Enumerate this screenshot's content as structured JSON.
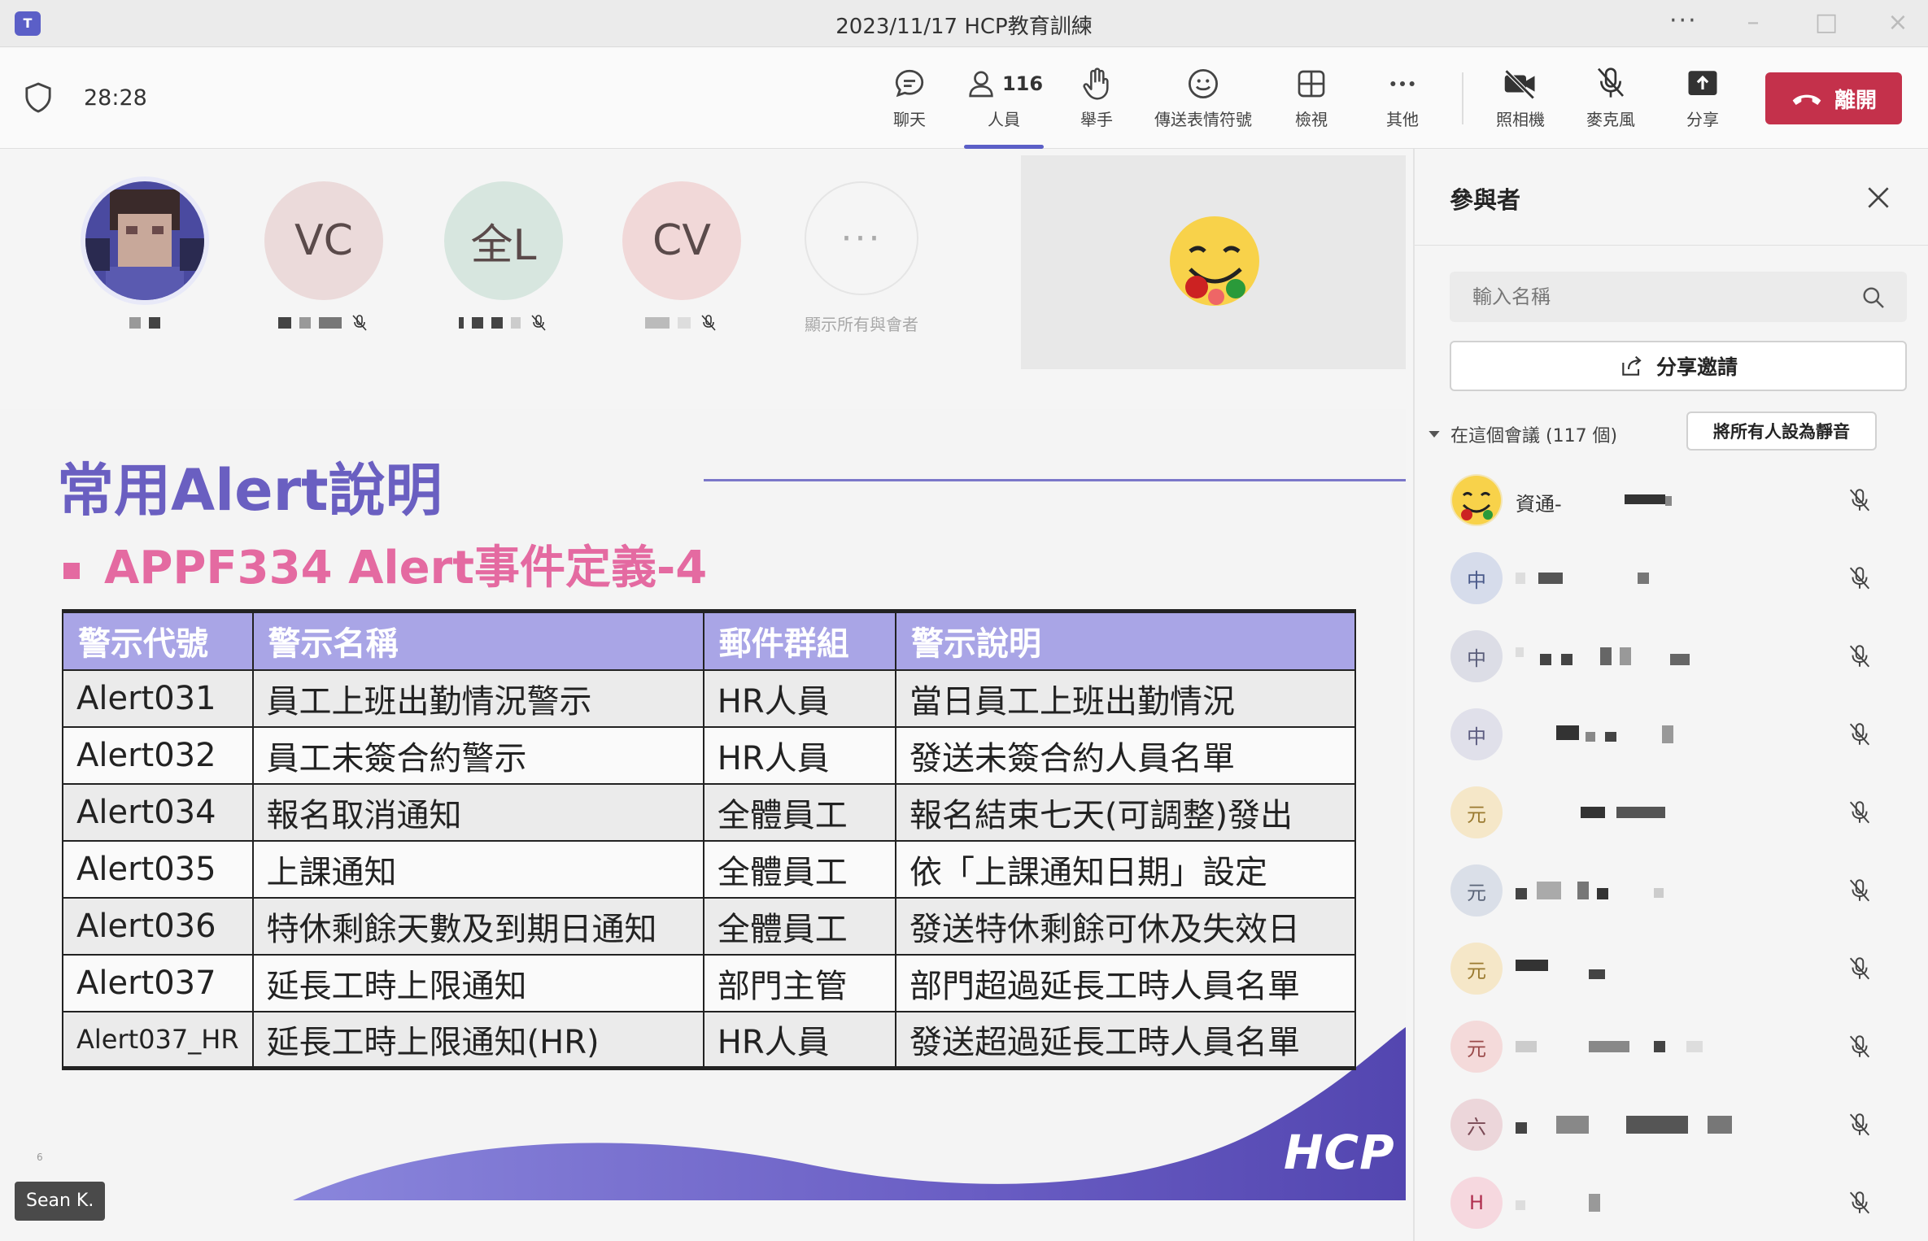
{
  "window": {
    "title": "2023/11/17 HCP教育訓練",
    "app_icon": "T"
  },
  "toolbar": {
    "timer": "28:28",
    "chat_label": "聊天",
    "people_label": "人員",
    "people_count": "116",
    "raise_hand_label": "舉手",
    "reactions_label": "傳送表情符號",
    "view_label": "檢視",
    "more_label": "其他",
    "camera_label": "照相機",
    "mic_label": "麥克風",
    "share_label": "分享",
    "leave_label": "離開"
  },
  "gallery": {
    "participants": [
      {
        "initials": "",
        "color": "#cfd2f0"
      },
      {
        "initials": "VC",
        "color": "#ebdada"
      },
      {
        "initials": "全L",
        "color": "#d7e6df"
      },
      {
        "initials": "CV",
        "color": "#f1d8d8"
      }
    ],
    "show_all_label": "顯示所有與會者"
  },
  "slide": {
    "title": "常用Alert說明",
    "subtitle": "APPF334 Alert事件定義-4",
    "table": {
      "headers": [
        "警示代號",
        "警示名稱",
        "郵件群組",
        "警示說明"
      ],
      "rows": [
        [
          "Alert031",
          "員工上班出勤情況警示",
          "HR人員",
          "當日員工上班出勤情況"
        ],
        [
          "Alert032",
          "員工未簽合約警示",
          "HR人員",
          "發送未簽合約人員名單"
        ],
        [
          "Alert034",
          "報名取消通知",
          "全體員工",
          "報名結束七天(可調整)發出"
        ],
        [
          "Alert035",
          "上課通知",
          "全體員工",
          "依「上課通知日期」設定"
        ],
        [
          "Alert036",
          "特休剩餘天數及到期日通知",
          "全體員工",
          "發送特休剩餘可休及失效日"
        ],
        [
          "Alert037",
          "延長工時上限通知",
          "部門主管",
          "部門超過延長工時人員名單"
        ],
        [
          "Alert037_HR",
          "延長工時上限通知(HR)",
          "HR人員",
          "發送超過延長工時人員名單"
        ]
      ]
    },
    "logo": "HCP",
    "page_number": "6",
    "speaker": "Sean K."
  },
  "panel": {
    "title": "參與者",
    "search_placeholder": "輸入名稱",
    "share_invite_label": "分享邀請",
    "in_meeting_label": "在這個會議 (117 個)",
    "mute_all_label": "將所有人設為靜音",
    "participants": [
      {
        "avatar": "",
        "name": "資通-",
        "color": "#f3e6b8",
        "text_color": "#7a5a00"
      },
      {
        "avatar": "中",
        "name": "",
        "color": "#d6dceb",
        "text_color": "#4a5a8a"
      },
      {
        "avatar": "中",
        "name": "",
        "color": "#dcdde6",
        "text_color": "#5a5d7a"
      },
      {
        "avatar": "中",
        "name": "",
        "color": "#e0e0ea",
        "text_color": "#5c5c80"
      },
      {
        "avatar": "元",
        "name": "",
        "color": "#f5e7c8",
        "text_color": "#9a7a30"
      },
      {
        "avatar": "元",
        "name": "",
        "color": "#dadfe8",
        "text_color": "#5a6478"
      },
      {
        "avatar": "元",
        "name": "",
        "color": "#f5e7c8",
        "text_color": "#9a7a30"
      },
      {
        "avatar": "元",
        "name": "",
        "color": "#f4dada",
        "text_color": "#9a4a4a"
      },
      {
        "avatar": "六",
        "name": "",
        "color": "#ecd6da",
        "text_color": "#7a4a55"
      },
      {
        "avatar": "H",
        "name": "",
        "color": "#f6d8df",
        "text_color": "#b03050"
      }
    ]
  },
  "colors": {
    "brand": "#5b5fc7",
    "leave": "#c4314b",
    "slide_title": "#6a5fc1",
    "slide_subtitle": "#e46aa1",
    "table_header": "#a9a5e6"
  }
}
